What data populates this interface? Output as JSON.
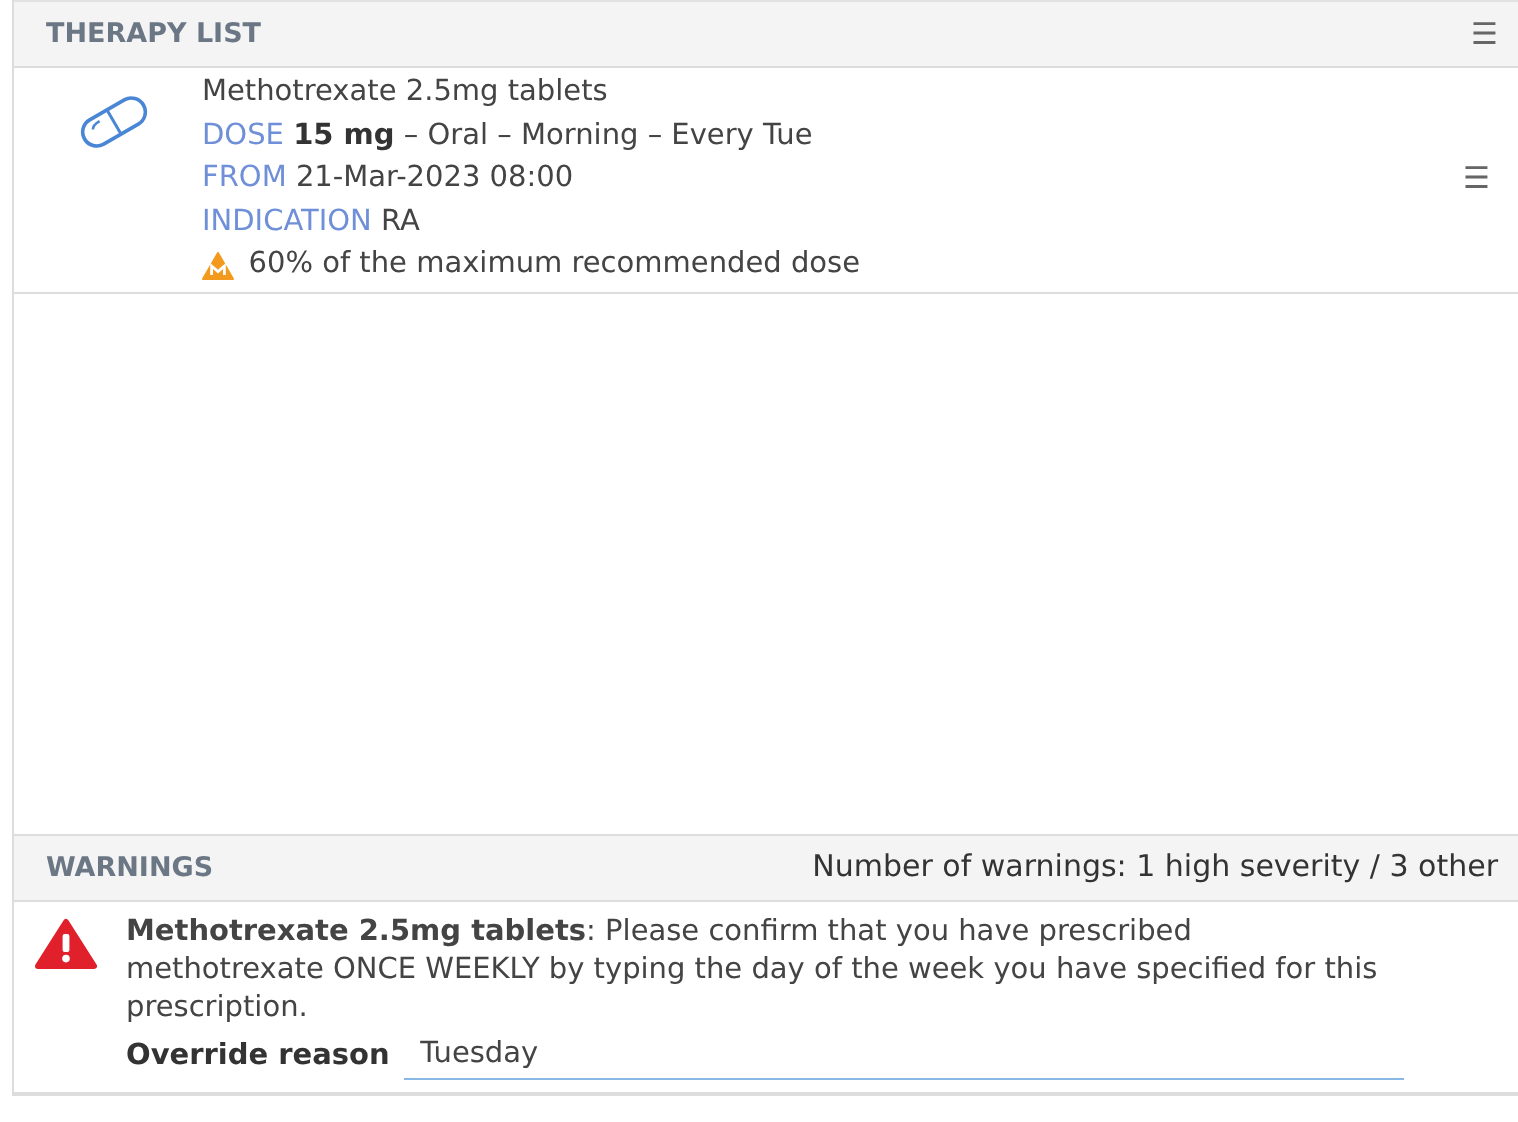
{
  "therapy_list": {
    "title": "THERAPY LIST",
    "menu_icon": "☰",
    "items": [
      {
        "name": "Methotrexate 2.5mg tablets",
        "dose_label": "DOSE",
        "dose_amount": "15 mg",
        "dose_details": "– Oral – Morning – Every Tue",
        "from_label": "FROM",
        "from_value": "21-Mar-2023 08:00",
        "indication_label": "INDICATION",
        "indication_value": "RA",
        "alert": "60% of the maximum recommended dose",
        "menu_icon": "☰"
      }
    ]
  },
  "warnings": {
    "title": "WARNINGS",
    "summary": "Number of warnings: 1 high severity / 3 other",
    "items": [
      {
        "kind": "alert",
        "message": "**Methotrexate 2.5mg tablets**: Please confirm that you have prescribed methotrexate ONCE WEEKLY by typing the day of the week you have specified for this prescription.",
        "override_label": "Override reason",
        "override_value": "Tuesday"
      }
    ]
  }
}
